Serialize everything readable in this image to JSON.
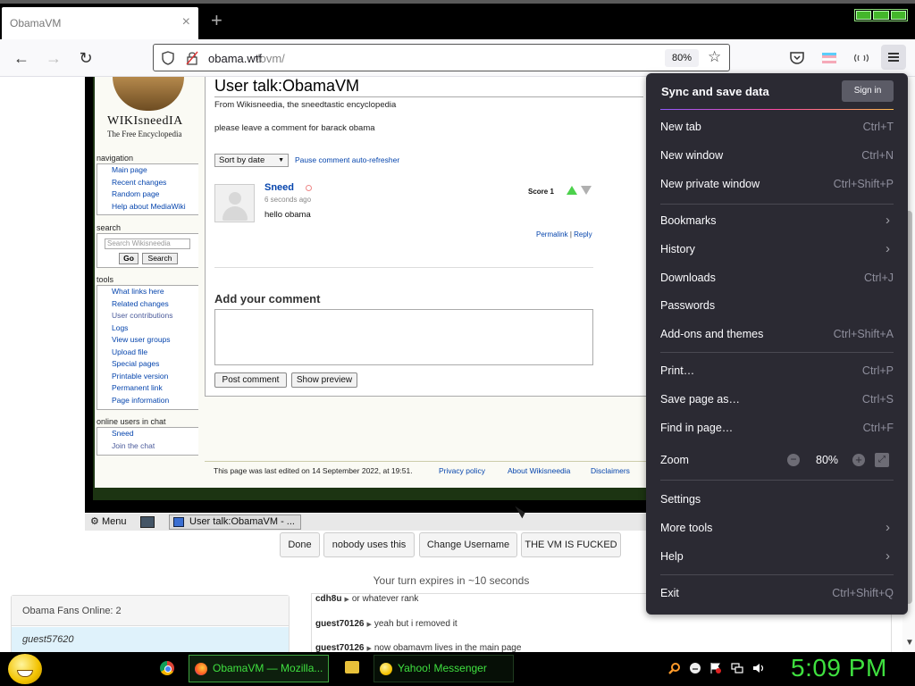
{
  "browser": {
    "tab_title": "ObamaVM",
    "tab_close": "×",
    "new_tab": "+",
    "url_domain": "obama.wtf",
    "url_path": "/ovm/",
    "zoom_badge": "80%"
  },
  "wiki": {
    "logo_text": "WIKIsneedIA",
    "logo_sub": "The Free Encyclopedia",
    "sidebar": {
      "navigation_title": "navigation",
      "navigation": [
        "Main page",
        "Recent changes",
        "Random page",
        "Help about MediaWiki"
      ],
      "search_title": "search",
      "search_placeholder": "Search Wikisneedia",
      "go_button": "Go",
      "search_button": "Search",
      "tools_title": "tools",
      "tools": [
        "What links here",
        "Related changes",
        "User contributions",
        "Logs",
        "View user groups",
        "Upload file",
        "Special pages",
        "Printable version",
        "Permanent link",
        "Page information"
      ],
      "online_title": "online users in chat",
      "online": [
        "Sneed",
        "Join the chat"
      ]
    },
    "page_title": "User talk:ObamaVM",
    "from_line": "From Wikisneedia, the sneedtastic encyclopedia",
    "leave_line": "please leave a comment for barack obama",
    "sort_label": "Sort by date",
    "pause_link": "Pause comment auto-refresher",
    "comment": {
      "user": "Sneed",
      "time": "6 seconds ago",
      "text": "hello obama",
      "score": "Score 1",
      "permalink": "Permalink",
      "separator": "|",
      "reply": "Reply"
    },
    "add_comment_title": "Add your comment",
    "post_button": "Post comment",
    "preview_button": "Show preview",
    "footer": {
      "edited": "This page was last edited on 14 September 2022, at 19:51.",
      "privacy": "Privacy policy",
      "about": "About Wikisneedia",
      "disclaimers": "Disclaimers"
    }
  },
  "vm_taskbar": {
    "menu_label": "Menu",
    "task_label": "User talk:ObamaVM - ..."
  },
  "vm_buttons": [
    "Done",
    "nobody uses this",
    "Change Username",
    "THE VM IS FUCKED"
  ],
  "turn_text": "Your turn expires in ~10 seconds",
  "online_panel": {
    "title": "Obama Fans Online: 2",
    "user": "guest57620"
  },
  "chat": [
    {
      "user": "cdh8u",
      "text": "or whatever rank"
    },
    {
      "user": "guest70126",
      "text": "yeah but i removed it"
    },
    {
      "user": "guest70126",
      "text": "now obamavm lives in the main page"
    }
  ],
  "app_menu": {
    "sync_title": "Sync and save data",
    "sign_in": "Sign in",
    "items_a": [
      {
        "label": "New tab",
        "shortcut": "Ctrl+T"
      },
      {
        "label": "New window",
        "shortcut": "Ctrl+N"
      },
      {
        "label": "New private window",
        "shortcut": "Ctrl+Shift+P"
      }
    ],
    "items_b": [
      {
        "label": "Bookmarks",
        "shortcut": ""
      },
      {
        "label": "History",
        "shortcut": ""
      },
      {
        "label": "Downloads",
        "shortcut": "Ctrl+J"
      },
      {
        "label": "Passwords",
        "shortcut": ""
      },
      {
        "label": "Add-ons and themes",
        "shortcut": "Ctrl+Shift+A"
      }
    ],
    "items_c": [
      {
        "label": "Print…",
        "shortcut": "Ctrl+P"
      },
      {
        "label": "Save page as…",
        "shortcut": "Ctrl+S"
      },
      {
        "label": "Find in page…",
        "shortcut": "Ctrl+F"
      }
    ],
    "zoom_label": "Zoom",
    "zoom_minus": "−",
    "zoom_value": "80%",
    "zoom_plus": "+",
    "zoom_full": "⤢",
    "items_d": [
      {
        "label": "Settings",
        "shortcut": ""
      },
      {
        "label": "More tools",
        "shortcut": ""
      },
      {
        "label": "Help",
        "shortcut": ""
      }
    ],
    "exit_label": "Exit",
    "exit_shortcut": "Ctrl+Shift+Q"
  },
  "taskbar": {
    "firefox_task": "ObamaVM — Mozilla...",
    "yahoo_task": "Yahoo! Messenger",
    "clock": "5:09 PM"
  },
  "colors": {
    "menu_bg": "#2b2a33",
    "taskbar_green": "#3fe03f",
    "wiki_link": "#0645ad"
  }
}
